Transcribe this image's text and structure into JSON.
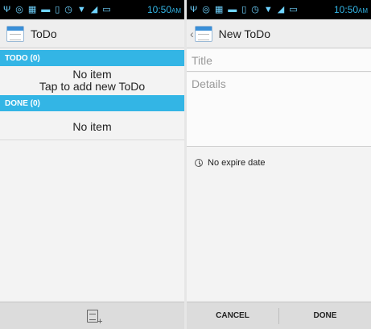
{
  "status_bar": {
    "time": "10:50",
    "ampm": "AM",
    "icons": [
      "usb-icon",
      "alarm-icon",
      "calendar-icon",
      "message-icon",
      "vibrate-icon",
      "clock-icon",
      "wifi-icon",
      "signal-icon",
      "battery-icon"
    ]
  },
  "todo_list": {
    "title": "ToDo",
    "sections": [
      {
        "header": "TODO (0)",
        "empty_line1": "No item",
        "empty_line2": "Tap to add new ToDo"
      },
      {
        "header": "DONE (0)",
        "empty_line1": "No item"
      }
    ]
  },
  "new_todo": {
    "title": "New ToDo",
    "title_placeholder": "Title",
    "details_placeholder": "Details",
    "expire_label": "No expire date",
    "cancel_label": "CANCEL",
    "done_label": "DONE"
  },
  "colors": {
    "accent": "#33b5e5",
    "statusbar_bg": "#000000"
  }
}
